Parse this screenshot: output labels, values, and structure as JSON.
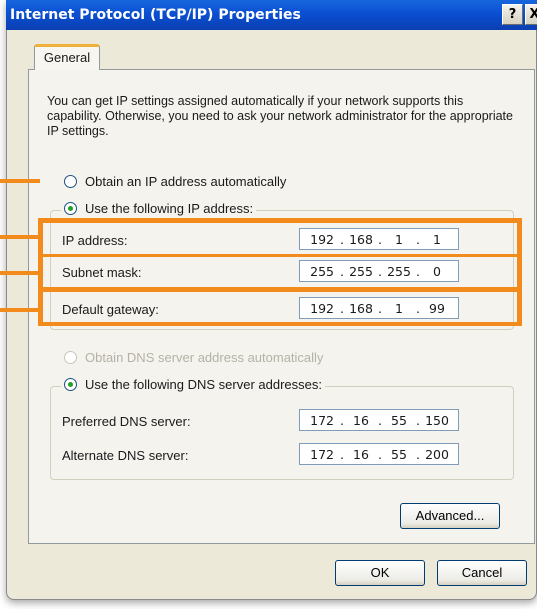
{
  "window": {
    "title": "Internet Protocol (TCP/IP) Properties",
    "help_label": "?",
    "close_label": "X"
  },
  "tabs": [
    {
      "label": "General",
      "selected": true
    }
  ],
  "intro_text": "You can get IP settings assigned automatically if your network supports this capability. Otherwise, you need to ask your network administrator for the appropriate IP settings.",
  "ip_section": {
    "auto_label": "Obtain an IP address automatically",
    "auto_selected": false,
    "manual_label": "Use the following IP address:",
    "manual_selected": true,
    "fields": {
      "ip_label": "IP address:",
      "ip_octets": [
        "192",
        "168",
        "1",
        "1"
      ],
      "subnet_label": "Subnet mask:",
      "subnet_octets": [
        "255",
        "255",
        "255",
        "0"
      ],
      "gateway_label": "Default gateway:",
      "gateway_octets": [
        "192",
        "168",
        "1",
        "99"
      ]
    }
  },
  "dns_section": {
    "auto_label": "Obtain DNS server address automatically",
    "auto_enabled": false,
    "manual_label": "Use the following DNS server addresses:",
    "manual_selected": true,
    "fields": {
      "preferred_label": "Preferred DNS server:",
      "preferred_octets": [
        "172",
        "16",
        "55",
        "150"
      ],
      "alternate_label": "Alternate DNS server:",
      "alternate_octets": [
        "172",
        "16",
        "55",
        "200"
      ]
    }
  },
  "buttons": {
    "advanced": "Advanced...",
    "ok": "OK",
    "cancel": "Cancel"
  },
  "colors": {
    "highlight": "#f28b1c",
    "titlebar": "#0a4fd1",
    "dialog_bg": "#ece9d8"
  }
}
